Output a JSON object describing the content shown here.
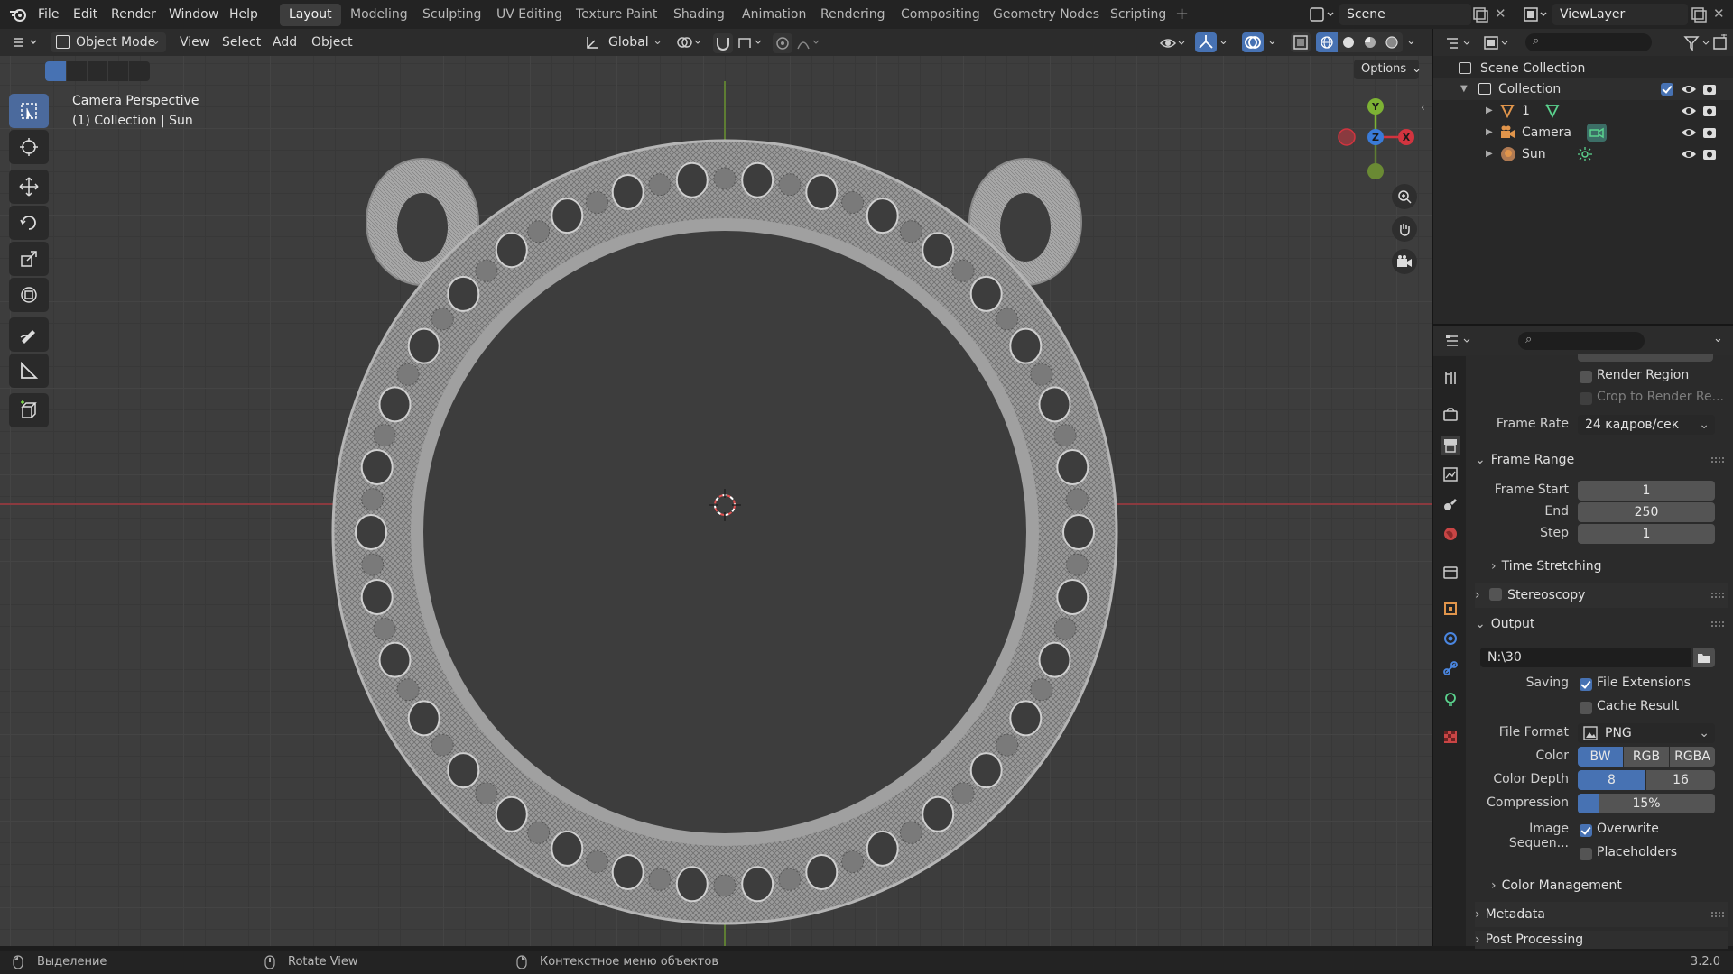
{
  "menu": {
    "file": "File",
    "edit": "Edit",
    "render": "Render",
    "window": "Window",
    "help": "Help"
  },
  "workspaces": [
    "Layout",
    "Modeling",
    "Sculpting",
    "UV Editing",
    "Texture Paint",
    "Shading",
    "Animation",
    "Rendering",
    "Compositing",
    "Geometry Nodes",
    "Scripting"
  ],
  "active_workspace": "Layout",
  "scene": {
    "name": "Scene",
    "view_layer": "ViewLayer"
  },
  "viewport_header": {
    "mode": "Object Mode",
    "view": "View",
    "select": "Select",
    "add": "Add",
    "object": "Object",
    "transform_orientation": "Global",
    "options": "Options"
  },
  "viewport_overlay": {
    "title": "Camera Perspective",
    "subtitle": "(1) Collection | Sun"
  },
  "gizmo": {
    "y": "Y",
    "z": "Z",
    "x": "X"
  },
  "outliner": {
    "root": "Scene Collection",
    "collection": "Collection",
    "items": [
      {
        "name": "1",
        "type": "mesh"
      },
      {
        "name": "Camera",
        "type": "camera"
      },
      {
        "name": "Sun",
        "type": "light"
      }
    ]
  },
  "properties": {
    "render_region": "Render Region",
    "crop": "Crop to Render Re...",
    "frame_rate_label": "Frame Rate",
    "frame_rate_value": "24 кадров/сек",
    "frame_range": "Frame Range",
    "frame_start_label": "Frame Start",
    "frame_start": "1",
    "end_label": "End",
    "end": "250",
    "step_label": "Step",
    "step": "1",
    "time_stretching": "Time Stretching",
    "stereoscopy": "Stereoscopy",
    "output": "Output",
    "output_path": "N:\\30",
    "saving_label": "Saving",
    "file_extensions": "File Extensions",
    "cache_result": "Cache Result",
    "file_format_label": "File Format",
    "file_format": "PNG",
    "color_label": "Color",
    "color_options": [
      "BW",
      "RGB",
      "RGBA"
    ],
    "color_depth_label": "Color Depth",
    "color_depth_options": [
      "8",
      "16"
    ],
    "compression_label": "Compression",
    "compression": "15%",
    "compression_value": 0.15,
    "image_sequence_label": "Image Sequen...",
    "overwrite": "Overwrite",
    "placeholders": "Placeholders",
    "color_management": "Color Management",
    "metadata": "Metadata",
    "post_processing": "Post Processing"
  },
  "status": {
    "left": "Выделение",
    "middle": "Rotate View",
    "right": "Контекстное меню объектов",
    "version": "3.2.0"
  },
  "colors": {
    "accent": "#4772b3",
    "x_axis": "#d2343f",
    "y_axis": "#7db234",
    "z_axis": "#3a7bd8"
  }
}
